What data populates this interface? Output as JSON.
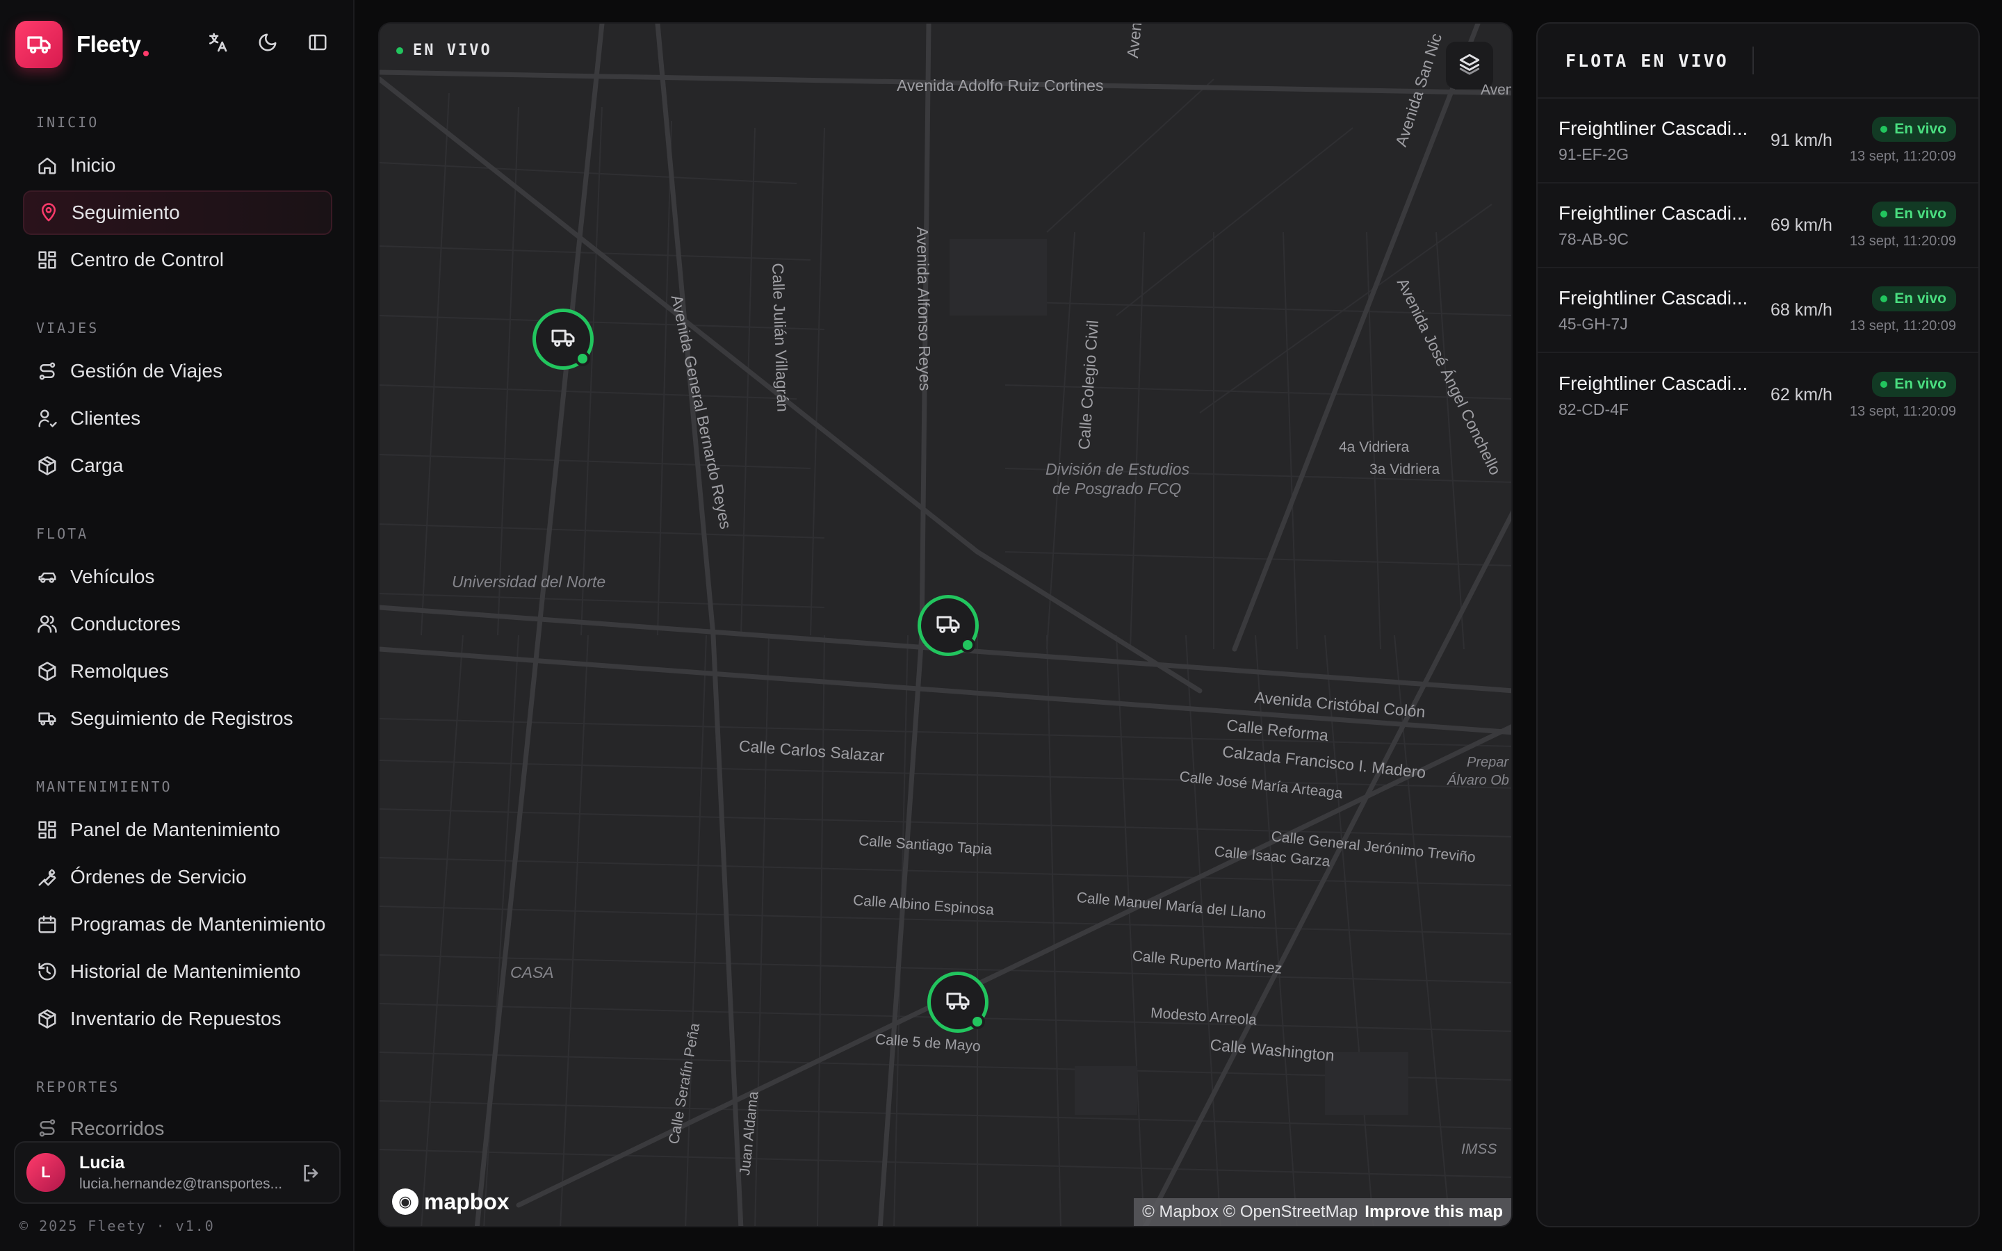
{
  "brand": {
    "name": "Fleety"
  },
  "sidebar": {
    "sections": [
      {
        "label": "INICIO",
        "items": [
          "Inicio",
          "Seguimiento",
          "Centro de Control"
        ]
      },
      {
        "label": "VIAJES",
        "items": [
          "Gestión de Viajes",
          "Clientes",
          "Carga"
        ]
      },
      {
        "label": "FLOTA",
        "items": [
          "Vehículos",
          "Conductores",
          "Remolques",
          "Seguimiento de Registros"
        ]
      },
      {
        "label": "MANTENIMIENTO",
        "items": [
          "Panel de Mantenimiento",
          "Órdenes de Servicio",
          "Programas de Mantenimiento",
          "Historial de Mantenimiento",
          "Inventario de Repuestos"
        ]
      },
      {
        "label": "REPORTES",
        "items": [
          "Recorridos"
        ]
      }
    ],
    "active_item": "Seguimiento"
  },
  "user": {
    "initial": "L",
    "name": "Lucia",
    "email": "lucia.hernandez@transportes..."
  },
  "footer": {
    "copyright": "© 2025 Fleety · v1.0"
  },
  "map": {
    "live_label": "EN VIVO",
    "labels": {
      "avenida_adolfo": "Avenida Adolfo Ruiz Cortines",
      "avenida": "Avenida",
      "aven": "Aven",
      "avenida_san_nic": "Avenida San Nic",
      "av_general_bernardo": "Avenida General Bernardo Reyes",
      "calle_julian": "Calle Julián Villagrán",
      "av_alfonso": "Avenida Alfonso Reyes",
      "av_jose_angel": "Avenida José Ángel Conchello",
      "division": "División de Estudios",
      "posgrado": "de Posgrado FCQ",
      "calle_colegio": "Calle Colegio Civil",
      "vidriera4": "4a Vidriera",
      "vidriera3": "3a Vidriera",
      "universidad": "Universidad del Norte",
      "cristobal": "Avenida Cristóbal Colón",
      "reforma": "Calle Reforma",
      "calzada": "Calzada Francisco I. Madero",
      "arteaga": "Calle José María Arteaga",
      "carlos_salazar": "Calle Carlos Salazar",
      "prepar": "Prepar",
      "alvaro": "Álvaro Ob",
      "santiago": "Calle Santiago Tapia",
      "jeronimo": "Calle General Jerónimo Treviño",
      "isaac": "Calle Isaac Garza",
      "albino": "Calle Albino Espinosa",
      "manuel": "Calle Manuel María del Llano",
      "ruperto": "Calle Ruperto Martínez",
      "casa": "CASA",
      "modesto": "Modesto Arreola",
      "washington": "Calle Washington",
      "cinco_mayo": "Calle 5 de Mayo",
      "serafin": "Calle Serafín Peña",
      "juan": "Juan Aldama",
      "imss": "IMSS"
    },
    "mapbox": "mapbox",
    "attribution": "© Mapbox © OpenStreetMap",
    "improve": "Improve this map"
  },
  "fleet": {
    "title": "FLOTA EN VIVO",
    "vehicles": [
      {
        "name": "Freightliner Cascadi...",
        "plate": "91-EF-2G",
        "speed": "91 km/h",
        "status": "En vivo",
        "time": "13 sept, 11:20:09"
      },
      {
        "name": "Freightliner Cascadi...",
        "plate": "78-AB-9C",
        "speed": "69 km/h",
        "status": "En vivo",
        "time": "13 sept, 11:20:09"
      },
      {
        "name": "Freightliner Cascadi...",
        "plate": "45-GH-7J",
        "speed": "68 km/h",
        "status": "En vivo",
        "time": "13 sept, 11:20:09"
      },
      {
        "name": "Freightliner Cascadi...",
        "plate": "82-CD-4F",
        "speed": "62 km/h",
        "status": "En vivo",
        "time": "13 sept, 11:20:09"
      }
    ]
  },
  "colors": {
    "accent": "#ff3b6b",
    "live": "#22c55e",
    "map_bg": "#262628"
  },
  "icons": [
    "truck-icon",
    "translate-icon",
    "moon-icon",
    "sidebar-toggle-icon",
    "home-icon",
    "map-pin-icon",
    "dashboard-icon",
    "route-icon",
    "users-icon",
    "box-icon",
    "car-icon",
    "wrench-icon",
    "calendar-icon",
    "history-icon",
    "logout-icon",
    "layers-icon"
  ]
}
